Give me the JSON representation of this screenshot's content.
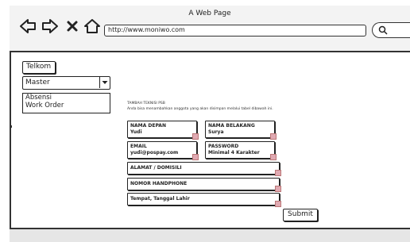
{
  "window": {
    "title": "A Web Page",
    "url": "http://www.moniwo.com"
  },
  "sidebar": {
    "company_button": "Telkom",
    "dropdown_selected": "Master",
    "menu_items": [
      "Absensi",
      "Work Order"
    ]
  },
  "form": {
    "heading": "TAMBAH TEKNISI PSB",
    "subheading": "Anda bisa menambahkan anggota yang akan disimpan melalui tabel dibawah ini.",
    "fields": {
      "first_name": {
        "label": "NAMA DEPAN",
        "value": "Yudi"
      },
      "last_name": {
        "label": "NAMA BELAKANG",
        "value": "Surya"
      },
      "email": {
        "label": "EMAIL",
        "value": "yudi@pospay.com"
      },
      "password": {
        "label": "PASSWORD",
        "value": "Minimal 4 Karakter"
      },
      "address": {
        "label": "ALAMAT / DOMISILI"
      },
      "phone": {
        "label": "NOMOR HANDPHONE"
      },
      "birth": {
        "label": "Tempat, Tanggal Lahir"
      }
    },
    "submit_label": "Submit"
  }
}
